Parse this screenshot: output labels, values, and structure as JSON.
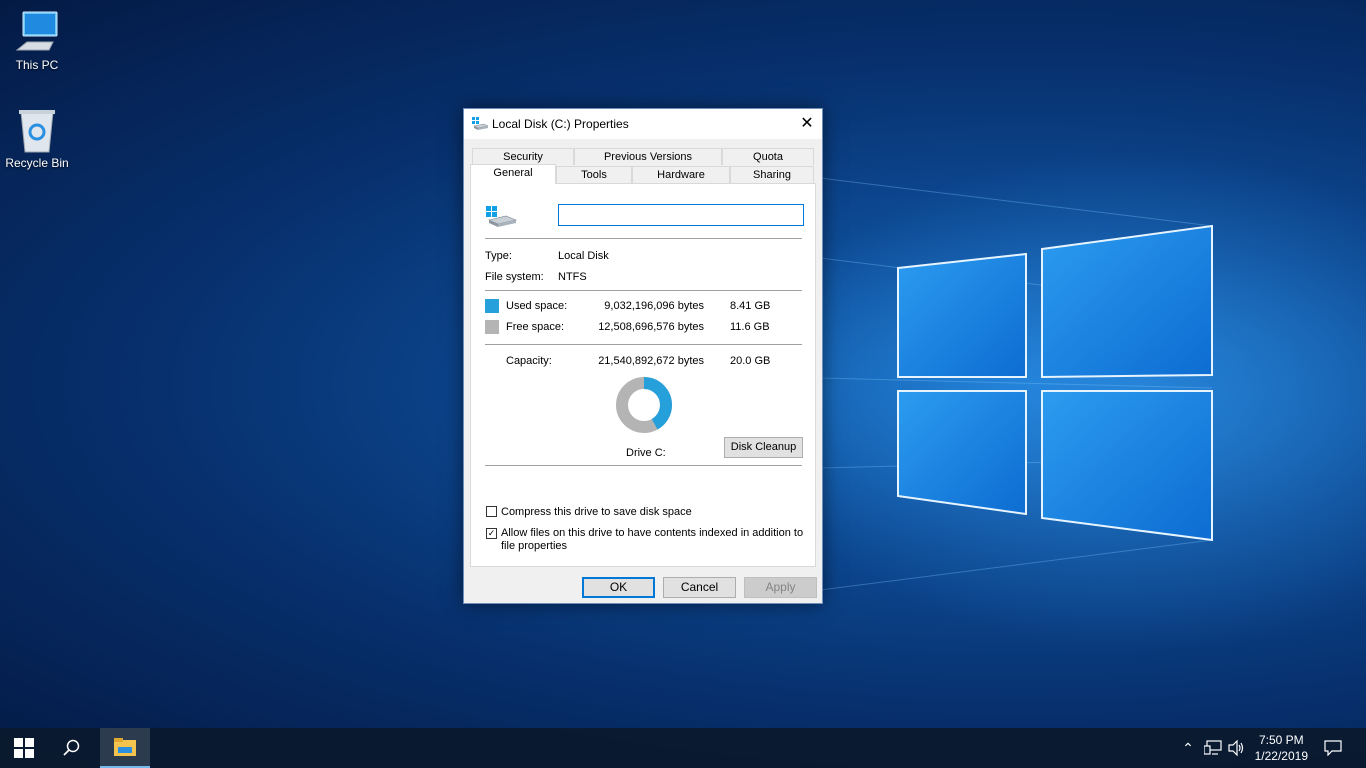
{
  "desktop": {
    "icons": [
      {
        "label": "This PC",
        "icon": "this-pc-icon"
      },
      {
        "label": "Recycle Bin",
        "icon": "recycle-bin-icon"
      }
    ]
  },
  "dialog": {
    "title": "Local Disk (C:) Properties",
    "tabs_row1": [
      "Security",
      "Previous Versions",
      "Quota"
    ],
    "tabs_row2": [
      "General",
      "Tools",
      "Hardware",
      "Sharing"
    ],
    "active_tab": "General",
    "name_field": {
      "value": ""
    },
    "type_label": "Type:",
    "type_value": "Local Disk",
    "fs_label": "File system:",
    "fs_value": "NTFS",
    "used": {
      "label": "Used space:",
      "bytes": "9,032,196,096 bytes",
      "size": "8.41 GB",
      "color": "#26a0da"
    },
    "free": {
      "label": "Free space:",
      "bytes": "12,508,696,576 bytes",
      "size": "11.6 GB",
      "color": "#b4b4b4"
    },
    "capacity": {
      "label": "Capacity:",
      "bytes": "21,540,892,672 bytes",
      "size": "20.0 GB"
    },
    "used_fraction": 0.419,
    "drive_label": "Drive C:",
    "disk_cleanup": "Disk Cleanup",
    "compress": {
      "label": "Compress this drive to save disk space",
      "checked": false
    },
    "index": {
      "label_line1": "Allow files on this drive to have contents indexed in addition to",
      "label_line2": "file properties",
      "checked": true
    },
    "ok": "OK",
    "cancel": "Cancel",
    "apply": "Apply"
  },
  "taskbar": {
    "time": "7:50 PM",
    "date": "1/22/2019",
    "colors": {
      "accent": "#0078d7"
    }
  }
}
